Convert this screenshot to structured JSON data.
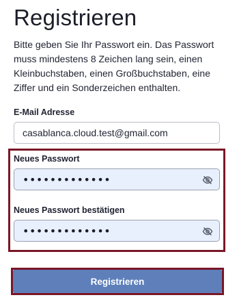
{
  "page": {
    "title": "Registrieren",
    "intro": "Bitte geben Sie Ihr Passwort ein. Das Passwort muss mindestens 8 Zeichen lang sein, einen Kleinbuchstaben, einen Großbuchstaben, eine Ziffer und ein Sonderzeichen enthalten."
  },
  "form": {
    "email": {
      "label": "E-Mail Adresse",
      "value": "casablanca.cloud.test@gmail.com"
    },
    "password": {
      "label": "Neues Passwort",
      "value": "•••••••••••••",
      "icon": "eye-off-icon"
    },
    "confirm": {
      "label": "Neues Passwort bestätigen",
      "value": "•••••••••••••",
      "icon": "eye-off-icon"
    },
    "submit_label": "Registrieren"
  },
  "colors": {
    "button": "#5e7fb9",
    "highlight": "#7a1627",
    "autofill": "#e8f0fe"
  }
}
